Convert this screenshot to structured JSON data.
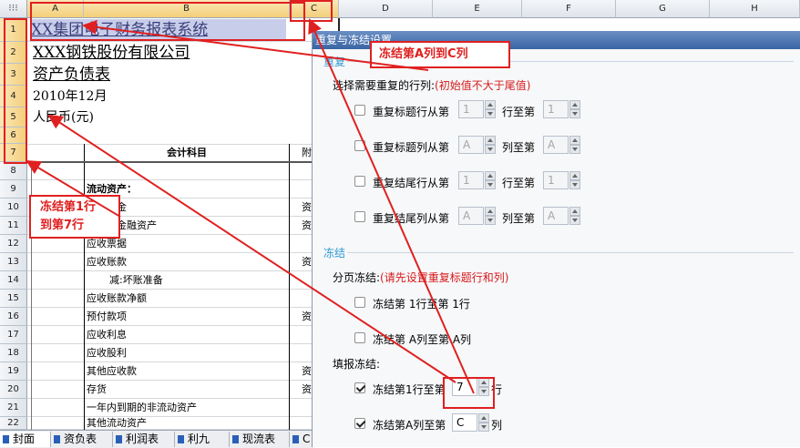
{
  "sheet": {
    "corner_glyph": "⁝⁝⁝",
    "columns": [
      "A",
      "B",
      "C",
      "D",
      "E",
      "F",
      "G",
      "H"
    ],
    "rows": [
      "1",
      "2",
      "3",
      "4",
      "5",
      "6",
      "7",
      "8",
      "9",
      "10",
      "11",
      "12",
      "13",
      "14",
      "15",
      "16",
      "17",
      "18",
      "19",
      "20",
      "21",
      "22"
    ],
    "cells": {
      "r1": "XX集团电子财务报表系统",
      "r2": "XXX钢铁股份有限公司",
      "r3": "资产负债表",
      "r4": "2010年12月",
      "r5": "人民币(元)",
      "r7b": "会计科目",
      "r7c": "附",
      "r9b": "流动资产：",
      "r10b": "货币资金",
      "r10c": "资",
      "r11b": "交易性金融资产",
      "r11c": "资",
      "r12b": "应收票据",
      "r13b": "应收账款",
      "r13c": "资",
      "r14b": "减:坏账准备",
      "r15b": "应收账款净额",
      "r16b": "预付款项",
      "r16c": "资",
      "r17b": "应收利息",
      "r18b": "应收股利",
      "r19b": "其他应收款",
      "r19c": "资",
      "r20b": "存货",
      "r20c": "资",
      "r21b": "一年内到期的非流动资产",
      "r22b": "其他流动资产"
    }
  },
  "tabs": [
    "封面",
    "资负表",
    "利润表",
    "利九",
    "现流表",
    "C"
  ],
  "dialog": {
    "title": "重复与冻结设置",
    "repeat_section": "重复",
    "repeat_prompt": "选择需要重复的行列:",
    "repeat_hint": "(初始值不大于尾值)",
    "repeat_title_rows_from": "重复标题行从第",
    "repeat_title_rows_to": "行至第",
    "repeat_title_cols_from": "重复标题列从第",
    "repeat_title_cols_to": "列至第",
    "repeat_tail_rows_from": "重复结尾行从第",
    "repeat_tail_rows_to": "行至第",
    "repeat_tail_cols_from": "重复结尾列从第",
    "repeat_tail_cols_to": "列至第",
    "spin_1": "1",
    "spin_A": "A",
    "freeze_section": "冻结",
    "page_freeze_prompt": "分页冻结:",
    "page_freeze_hint": "(请先设置重复标题行和列)",
    "page_freeze_rows": "冻结第  1行至第  1行",
    "page_freeze_cols": "冻结第  A列至第  A列",
    "fill_freeze_prompt": "填报冻结:",
    "fill_freeze_rows_from": "冻结第1行至第",
    "fill_freeze_rows_value": "7",
    "fill_freeze_rows_unit": "行",
    "fill_freeze_cols_from": "冻结第A列至第",
    "fill_freeze_cols_value": "C",
    "fill_freeze_cols_unit": "列"
  },
  "annotations": {
    "freeze_cols_note": "冻结第A列到C列",
    "freeze_rows_note_line1": "冻结第1行",
    "freeze_rows_note_line2": "到第7行"
  },
  "colors": {
    "annotation_red": "#e02020",
    "dialog_title_bg": "#3a64a4",
    "section_blue": "#2f9bd4",
    "hint_red": "#d61a1a"
  }
}
